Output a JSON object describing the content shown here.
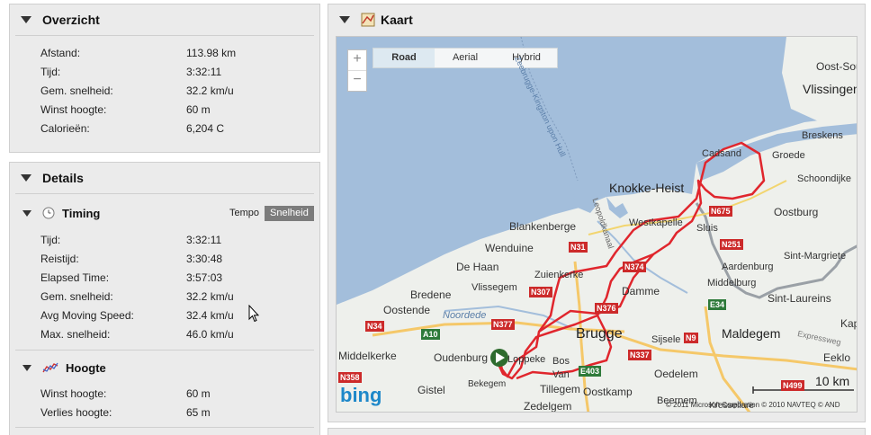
{
  "overview": {
    "title": "Overzicht",
    "rows": [
      {
        "label": "Afstand:",
        "value": "113.98 km"
      },
      {
        "label": "Tijd:",
        "value": "3:32:11"
      },
      {
        "label": "Gem. snelheid:",
        "value": "32.2 km/u"
      },
      {
        "label": "Winst hoogte:",
        "value": "60 m"
      },
      {
        "label": "Calorieën:",
        "value": "6,204 C"
      }
    ]
  },
  "details": {
    "title": "Details",
    "timing": {
      "title": "Timing",
      "toggle": [
        "Tempo",
        "Snelheid"
      ],
      "active": "Snelheid",
      "rows": [
        {
          "label": "Tijd:",
          "value": "3:32:11"
        },
        {
          "label": "Reistijd:",
          "value": "3:30:48"
        },
        {
          "label": "Elapsed Time:",
          "value": "3:57:03"
        },
        {
          "label": "Gem. snelheid:",
          "value": "32.2 km/u"
        },
        {
          "label": "Avg Moving Speed:",
          "value": "32.4 km/u"
        },
        {
          "label": "Max. snelheid:",
          "value": "46.0 km/u"
        }
      ]
    },
    "elevation": {
      "title": "Hoogte",
      "rows": [
        {
          "label": "Winst hoogte:",
          "value": "60 m"
        },
        {
          "label": "Verlies hoogte:",
          "value": "65 m"
        }
      ]
    }
  },
  "map": {
    "title": "Kaart",
    "map_types": [
      "Road",
      "Aerial",
      "Hybrid"
    ],
    "active_type": "Road",
    "scale": "10 km",
    "logo": "bing",
    "copyright": "© 2011 Microsoft Corporation  © 2010 NAVTEQ  © AND",
    "places": [
      "Oost-Sou",
      "Vlissingen",
      "Breskens",
      "Cadsand",
      "Groede",
      "Schoondijke",
      "Knokke-Heist",
      "Oostburg",
      "Blankenberge",
      "Westkapelle",
      "Sluis",
      "Wenduine",
      "De Haan",
      "Zuienkerke",
      "Aardenburg",
      "Sint-Margriete",
      "Vlissegem",
      "Middelburg",
      "Bredene",
      "Damme",
      "Sint-Laureins",
      "Oostende",
      "Noordede",
      "Brugge",
      "Maldegem",
      "Sijsele",
      "Middelkerke",
      "Oudenburg",
      "Loppeke",
      "Bos",
      "Van",
      "Oedelem",
      "Eeklo",
      "Bekegem",
      "Tillegem",
      "Oostkamp",
      "Gistel",
      "Zedelgem",
      "Beernem",
      "Kressellare",
      "Leopoldkanaal",
      "Zeebrugge-Kingston upon Hull",
      "Expressweg",
      "Kap"
    ],
    "roads": [
      "N675",
      "N31",
      "N251",
      "N374",
      "N307",
      "N376",
      "E34",
      "N34",
      "N377",
      "A10",
      "N9",
      "N337",
      "N358",
      "E403",
      "N499"
    ]
  },
  "colors": {
    "route": "#e0262d",
    "panel_bg": "#ebebeb",
    "active_toggle": "#7c7c7c",
    "road_label": "#cc2a2a"
  }
}
